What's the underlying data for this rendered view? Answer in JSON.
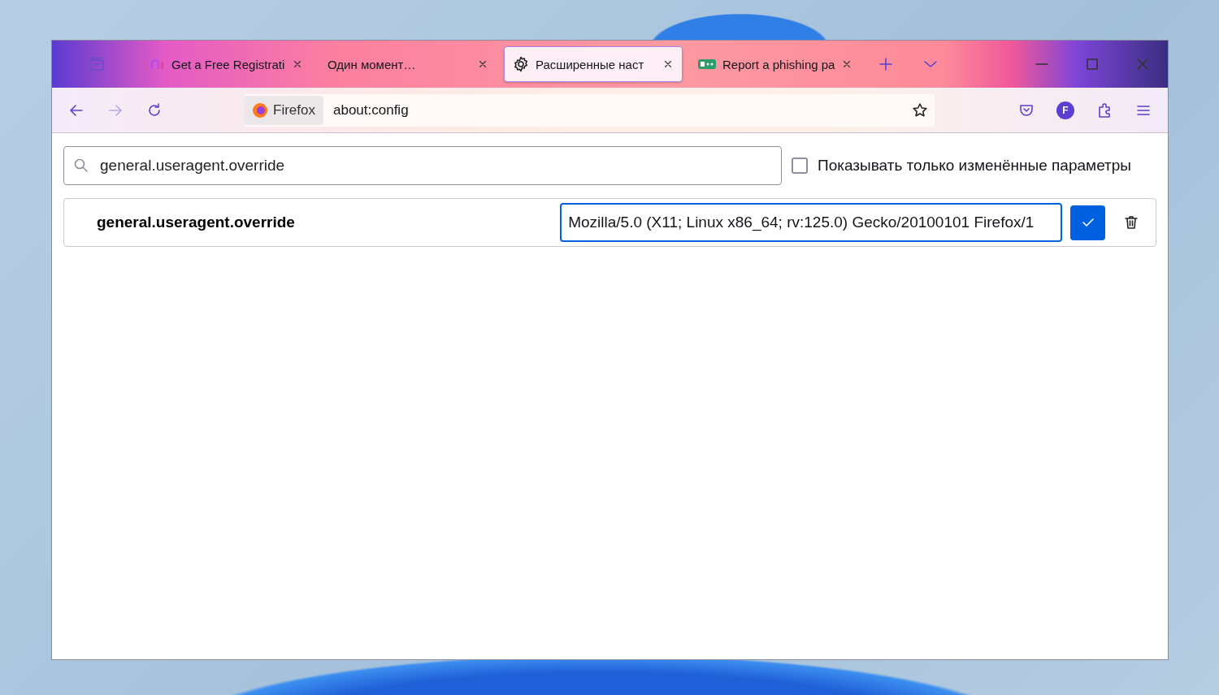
{
  "tabs": [
    {
      "kind": "logo",
      "title": "Get a Free Registrati",
      "selected": false
    },
    {
      "kind": "none",
      "title": "Один момент…",
      "selected": false
    },
    {
      "kind": "gear",
      "title": "Расширенные наст",
      "selected": true
    },
    {
      "kind": "badge",
      "title": "Report a phishing pa",
      "selected": false
    }
  ],
  "toolbar": {
    "forward_disabled": true,
    "identity": "Firefox",
    "url": "about:config",
    "account_initial": "F"
  },
  "search": {
    "value": "general.useragent.override"
  },
  "modified_only": {
    "label": "Показывать только изменённые параметры",
    "checked": false
  },
  "preference": {
    "name": "general.useragent.override",
    "value": "Mozilla/5.0 (X11; Linux x86_64; rv:125.0) Gecko/20100101 Firefox/1"
  }
}
